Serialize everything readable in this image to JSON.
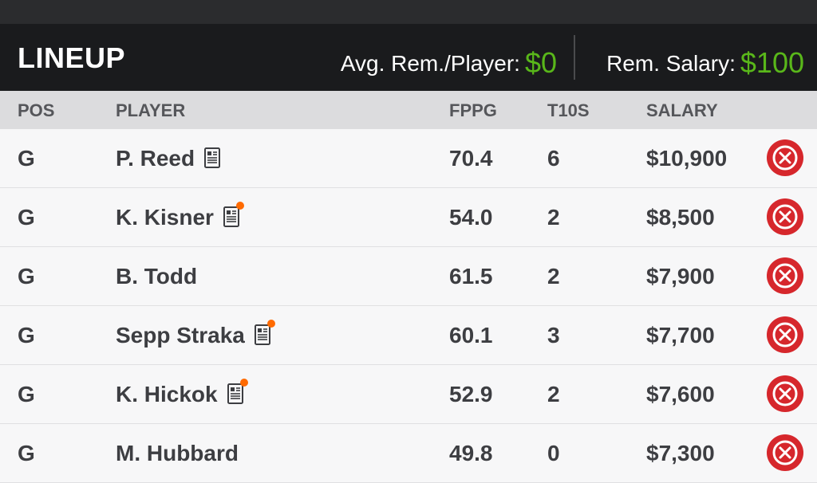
{
  "header": {
    "title": "LINEUP",
    "avg_label": "Avg. Rem./Player:",
    "avg_value": "$0",
    "rem_label": "Rem. Salary:",
    "rem_value": "$100"
  },
  "columns": {
    "pos": "POS",
    "player": "PLAYER",
    "fppg": "FPPG",
    "t10s": "T10S",
    "salary": "SALARY"
  },
  "rows": [
    {
      "pos": "G",
      "player": "P. Reed",
      "news_icon": "player-news-icon",
      "news_alert": false,
      "fppg": "70.4",
      "t10s": "6",
      "salary": "$10,900"
    },
    {
      "pos": "G",
      "player": "K. Kisner",
      "news_icon": "player-news-icon",
      "news_alert": true,
      "fppg": "54.0",
      "t10s": "2",
      "salary": "$8,500"
    },
    {
      "pos": "G",
      "player": "B. Todd",
      "news_icon": null,
      "news_alert": false,
      "fppg": "61.5",
      "t10s": "2",
      "salary": "$7,900"
    },
    {
      "pos": "G",
      "player": "Sepp Straka",
      "news_icon": "player-news-icon",
      "news_alert": true,
      "fppg": "60.1",
      "t10s": "3",
      "salary": "$7,700"
    },
    {
      "pos": "G",
      "player": "K. Hickok",
      "news_icon": "player-news-icon",
      "news_alert": true,
      "fppg": "52.9",
      "t10s": "2",
      "salary": "$7,600"
    },
    {
      "pos": "G",
      "player": "M. Hubbard",
      "news_icon": null,
      "news_alert": false,
      "fppg": "49.8",
      "t10s": "0",
      "salary": "$7,300"
    }
  ],
  "colors": {
    "accent_green": "#59b71a",
    "remove_red": "#d6272c",
    "alert_orange": "#ff6a00",
    "header_bg": "#1a1b1d"
  }
}
